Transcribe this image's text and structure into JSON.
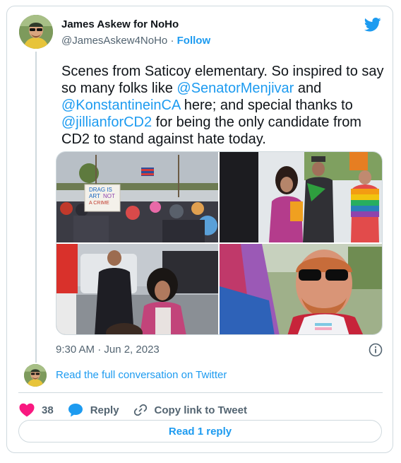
{
  "author": {
    "name": "James Askew for NoHo",
    "handle": "@JamesAskew4NoHo",
    "separator": "·",
    "follow_label": "Follow"
  },
  "tweet": {
    "text_parts": [
      "Scenes from Saticoy elementary. So inspired to say so many folks like ",
      "@SenatorMenjivar",
      " and ",
      "@KonstantineinCA",
      " here; and special thanks to ",
      "@jillianforCD2",
      " for being the only candidate from CD2 to stand against hate today."
    ],
    "timestamp": "9:30 AM · Jun 2, 2023"
  },
  "media": {
    "sign_lines": [
      "DRAG IS",
      "ART",
      "NOT",
      "A CRIME"
    ]
  },
  "conversation_link": "Read the full conversation on Twitter",
  "actions": {
    "like_count": "38",
    "reply_label": "Reply",
    "copy_label": "Copy link to Tweet"
  },
  "read_replies_label": "Read 1 reply",
  "colors": {
    "link_blue": "#1d9bf0",
    "like_red": "#f91880",
    "text_dark": "#0f1419",
    "text_gray": "#536471",
    "border": "#cfd9de"
  },
  "icons": [
    "twitter-bird-icon",
    "info-icon",
    "heart-icon",
    "reply-bubble-icon",
    "link-icon"
  ]
}
